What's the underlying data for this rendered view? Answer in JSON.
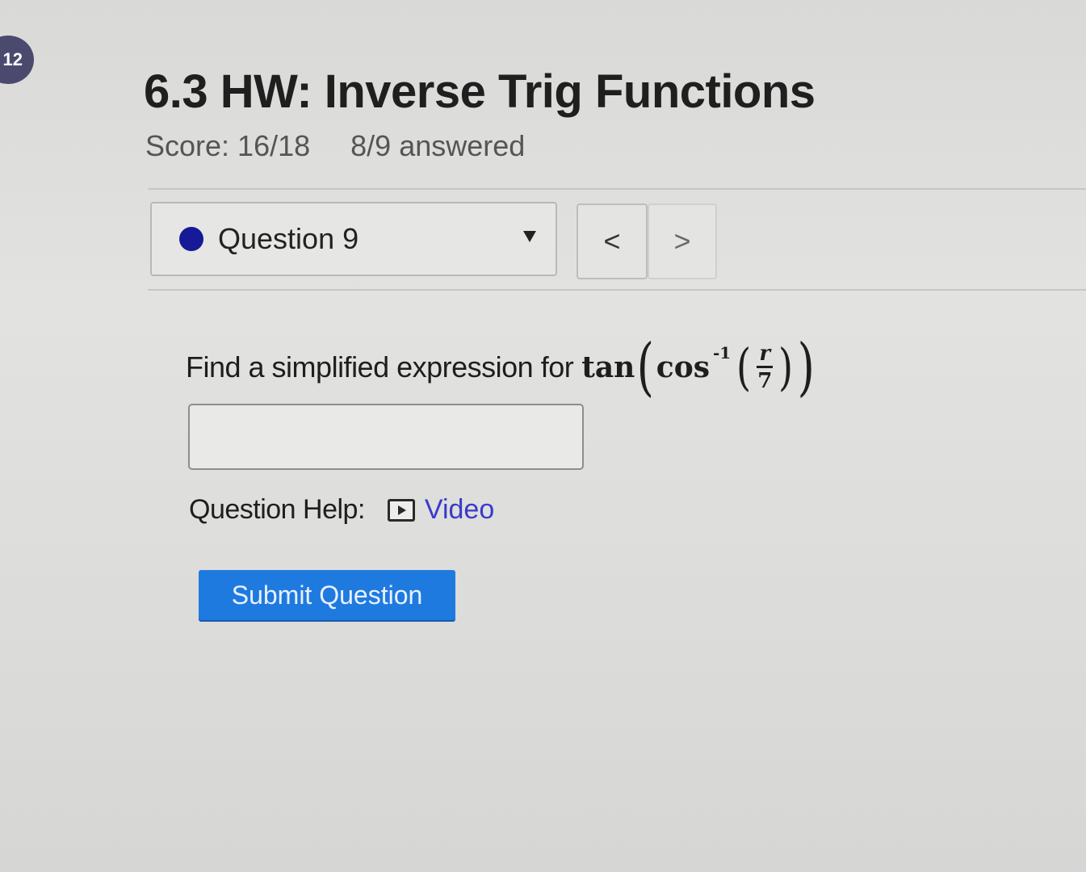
{
  "page_badge": "12",
  "assignment": {
    "title": "6.3 HW: Inverse Trig Functions",
    "score": "Score: 16/18",
    "answered": "8/9 answered"
  },
  "navigator": {
    "selected_question": "Question 9",
    "prev_glyph": "<",
    "next_glyph": ">"
  },
  "question": {
    "prompt": "Find a simplified expression for",
    "math": {
      "outer_fn": "tan",
      "inner_fn": "cos",
      "exponent": "-1",
      "numerator": "r",
      "denominator": "7"
    }
  },
  "answer": {
    "value": "",
    "placeholder": ""
  },
  "help": {
    "label": "Question Help:",
    "video_label": "Video"
  },
  "submit_label": "Submit Question",
  "colors": {
    "status_dot": "#161a96",
    "submit": "#1f7ae0",
    "link": "#3a3acb",
    "badge": "#4b4a6e"
  },
  "icons": [
    "status-dot-icon",
    "caret-down-icon",
    "chevron-left-icon",
    "chevron-right-icon",
    "video-play-icon"
  ]
}
